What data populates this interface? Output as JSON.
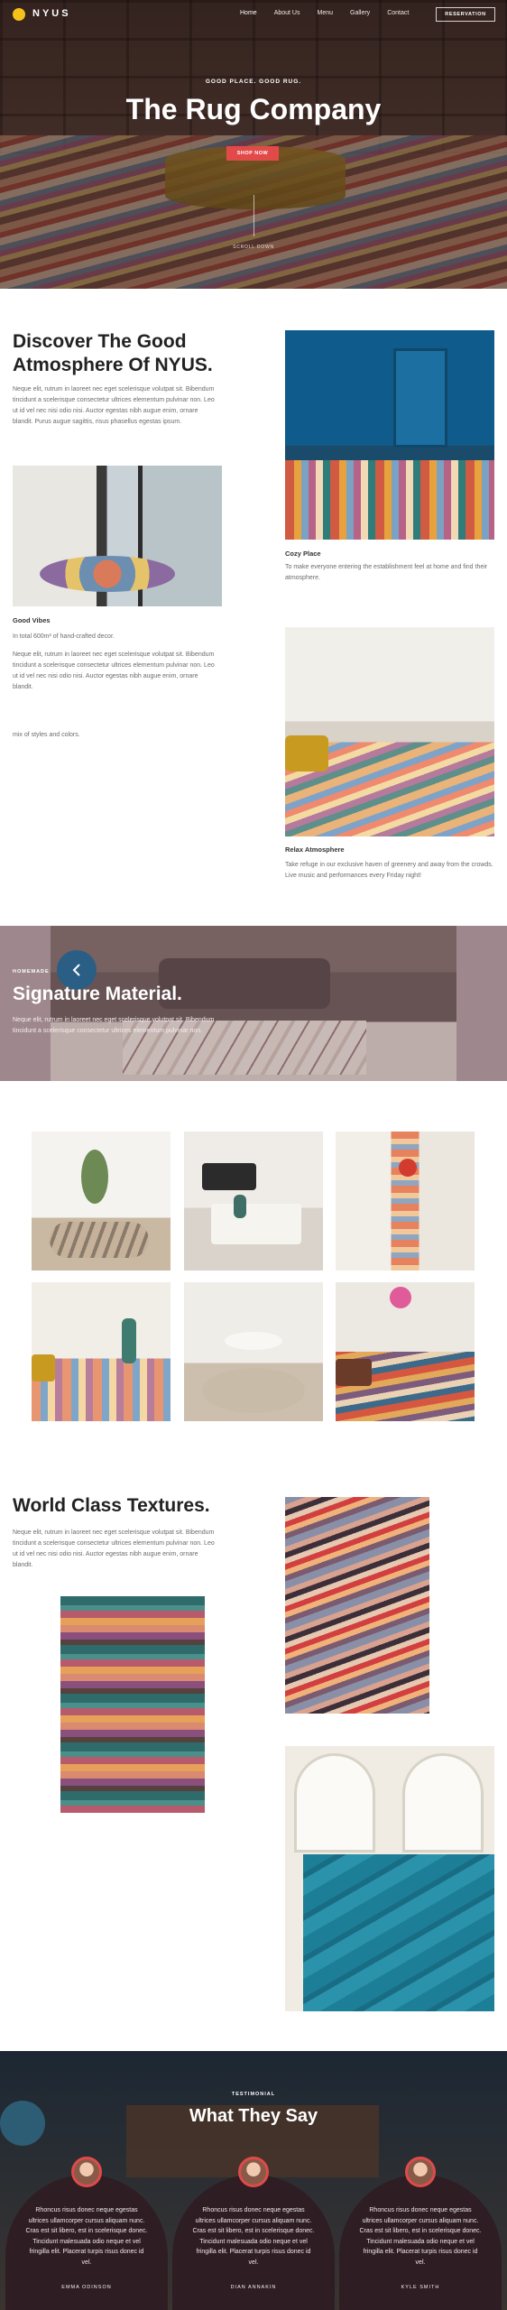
{
  "nav": {
    "logo": "NYUS",
    "links": [
      "Home",
      "About Us",
      "Menu",
      "Gallery",
      "Contact"
    ],
    "reserve": "RESERVATION"
  },
  "hero": {
    "kicker": "GOOD PLACE. GOOD RUG.",
    "title": "The Rug Company",
    "button": "SHOP NOW",
    "scroll": "SCROLL DOWN"
  },
  "about": {
    "title": "Discover The Good Atmosphere Of NYUS.",
    "text": "Neque elit, rutrum in laoreet nec eget scelerisque volutpat sit. Bibendum tincidunt a scelerisque consectetur ultrices elementum pulvinar non. Leo ut id vel nec nisi odio nisi. Auctor egestas nibh augue enim, ornare blandit. Purus augue sagittis, risus phasellus egestas ipsum.",
    "cozy_caption": "Cozy Place",
    "cozy_text": "To make everyone entering the establishment feel at home and find their atmosphere.",
    "good_caption": "Good Vibes",
    "good_text1": "In total 600m² of hand-crafted decor.",
    "good_text2": "Neque elit, rutrum in laoreet nec eget scelerisque volutpat sit. Bibendum tincidunt a scelerisque consectetur ultrices elementum pulvinar non. Leo ut id vel nec nisi odio nisi. Auctor egestas nibh augue enim, ornare blandit.",
    "mix_text": "mix of styles and colors.",
    "relax_caption": "Relax Atmosphere",
    "relax_text": "Take refuge in our exclusive haven of greenery and away from the crowds. Live music and performances every Friday night!"
  },
  "banner": {
    "kicker": "HOMEMADE",
    "title": "Signature Material.",
    "text": "Neque elit, rutrum in laoreet nec eget scelerisque volutpat sit. Bibendum tincidunt a scelerisque consectetur ultrices elementum pulvinar non."
  },
  "textures": {
    "title": "World Class Textures.",
    "text": "Neque elit, rutrum in laoreet nec eget scelerisque volutpat sit. Bibendum tincidunt a scelerisque consectetur ultrices elementum pulvinar non. Leo ut id vel nec nisi odio nisi. Auctor egestas nibh augue enim, ornare blandit."
  },
  "testimonials": {
    "kicker": "TESTIMONIAL",
    "title": "What They Say",
    "items": [
      {
        "text": "Rhoncus risus donec neque egestas ultrices ullamcorper cursus aliquam nunc. Cras est sit libero, est in scelerisque donec. Tincidunt malesuada odio neque et vel fringilla elit. Placerat turpis risus donec id vel.",
        "name": "EMMA ODINSON"
      },
      {
        "text": "Rhoncus risus donec neque egestas ultrices ullamcorper cursus aliquam nunc. Cras est sit libero, est in scelerisque donec. Tincidunt malesuada odio neque et vel fringilla elit. Placerat turpis risus donec id vel.",
        "name": "DIAN ANNAKIN"
      },
      {
        "text": "Rhoncus risus donec neque egestas ultrices ullamcorper cursus aliquam nunc. Cras est sit libero, est in scelerisque donec. Tincidunt malesuada odio neque et vel fringilla elit. Placerat turpis risus donec id vel.",
        "name": "KYLE SMITH"
      }
    ]
  },
  "colors": {
    "accent": "#e24a4a",
    "logo": "#f4c21b",
    "card": "#2e1e24",
    "slider_button": "#2b5e84"
  },
  "icons": [
    "logo-circle-icon",
    "chevron-left-icon"
  ]
}
